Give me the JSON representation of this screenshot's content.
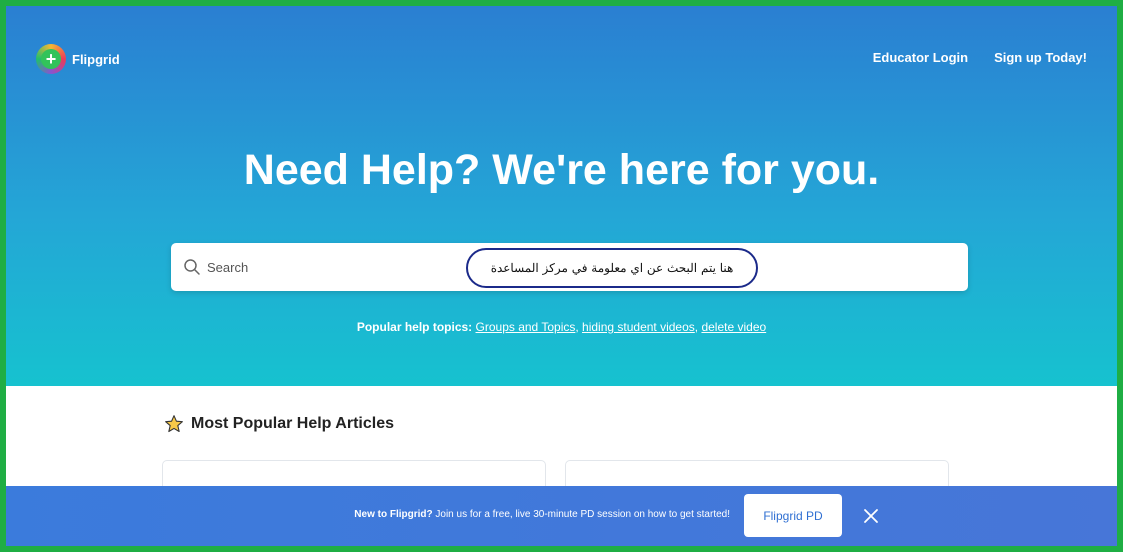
{
  "header": {
    "logo_text": "Flipgrid",
    "nav": [
      {
        "label": "Educator Login"
      },
      {
        "label": "Sign up Today!"
      }
    ]
  },
  "hero": {
    "headline": "Need Help? We're here for you.",
    "search_placeholder": "Search",
    "annotation": "هنا يتم البحث عن اي معلومة في مركز المساعدة",
    "topics_label": "Popular help topics:",
    "topics": [
      {
        "label": "Groups and Topics"
      },
      {
        "label": "hiding student videos"
      },
      {
        "label": "delete video"
      }
    ]
  },
  "articles": {
    "title": "Most Popular Help Articles"
  },
  "banner": {
    "lead": "New to Flipgrid?",
    "text": " Join us for a free, live 30-minute PD session on how to get started!",
    "button_label": "Flipgrid PD"
  },
  "colors": {
    "frame": "#1fae44",
    "hero_top": "#2a7fd2",
    "hero_bottom": "#16c2cf",
    "banner": "#3b7bdc"
  },
  "icons": [
    "logo-icon",
    "search-icon",
    "star-icon",
    "close-icon"
  ]
}
